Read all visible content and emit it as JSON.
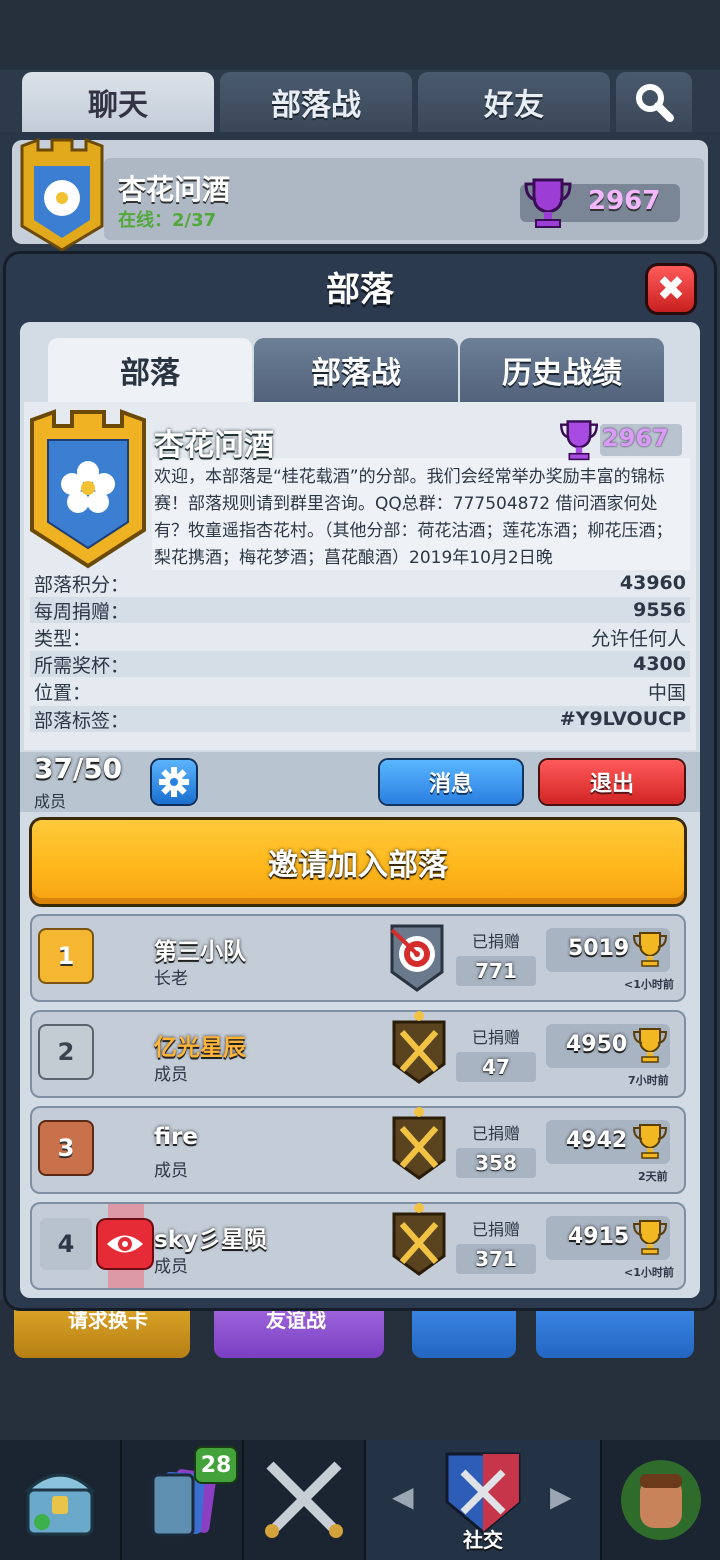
{
  "background": {
    "tabs": [
      "聊天",
      "部落战",
      "好友"
    ],
    "clan_name": "杏花问酒",
    "online": "在线：2/37",
    "trophies": "2967",
    "buttons": [
      "请求换卡",
      "友谊战"
    ]
  },
  "nav": {
    "cards_badge": "28",
    "social_label": "社交"
  },
  "modal": {
    "title": "部落",
    "close": "✖",
    "tabs": [
      "部落",
      "部落战",
      "历史战绩"
    ],
    "active_tab": 0
  },
  "clan": {
    "name": "杏花问酒",
    "trophies": "2967",
    "description": "欢迎，本部落是“桂花载酒”的分部。我们会经常举办奖励丰富的锦标赛！部落规则请到群里咨询。QQ总群：777504872 借问酒家何处有？牧童遥指杏花村。（其他分部：荷花沽酒；莲花冻酒；柳花压酒；梨花携酒；梅花梦酒；菖花酿酒）2019年10月2日晚",
    "stats": [
      {
        "label": "部落积分：",
        "value": "43960"
      },
      {
        "label": "每周捐赠：",
        "value": "9556"
      },
      {
        "label": "类型：",
        "value": "允许任何人"
      },
      {
        "label": "所需奖杯：",
        "value": "4300"
      },
      {
        "label": "位置：",
        "value": "中国"
      },
      {
        "label": "部落标签：",
        "value": "#Y9LVOUCP"
      }
    ]
  },
  "members_bar": {
    "count": "37/50",
    "label": "成员",
    "message_button": "消息",
    "leave_button": "退出"
  },
  "invite_button": "邀请加入部落",
  "donated_label": "已捐赠",
  "members": [
    {
      "rank": "1",
      "name": "第三小队",
      "role": "长老",
      "donated": "771",
      "trophies": "5019",
      "last_seen": "<1小时前",
      "rank_color": "#f5b731",
      "name_color": "#ffffff",
      "arena": "target-arena-icon"
    },
    {
      "rank": "2",
      "name": "亿光星辰",
      "role": "成员",
      "donated": "47",
      "trophies": "4950",
      "last_seen": "7小时前",
      "rank_color": "#b7c0c8",
      "name_color": "#ffb43a",
      "arena": "crossed-swords-arena-icon"
    },
    {
      "rank": "3",
      "name": "fire",
      "role": "成员",
      "donated": "358",
      "trophies": "4942",
      "last_seen": "2天前",
      "rank_color": "#c9714a",
      "name_color": "#ffffff",
      "arena": "crossed-swords-arena-icon"
    },
    {
      "rank": "4",
      "name": "sky彡星陨",
      "role": "成员",
      "donated": "371",
      "trophies": "4915",
      "last_seen": "<1小时前",
      "rank_color": "#b1bcc8",
      "name_color": "#ffffff",
      "arena": "crossed-swords-arena-icon"
    }
  ]
}
